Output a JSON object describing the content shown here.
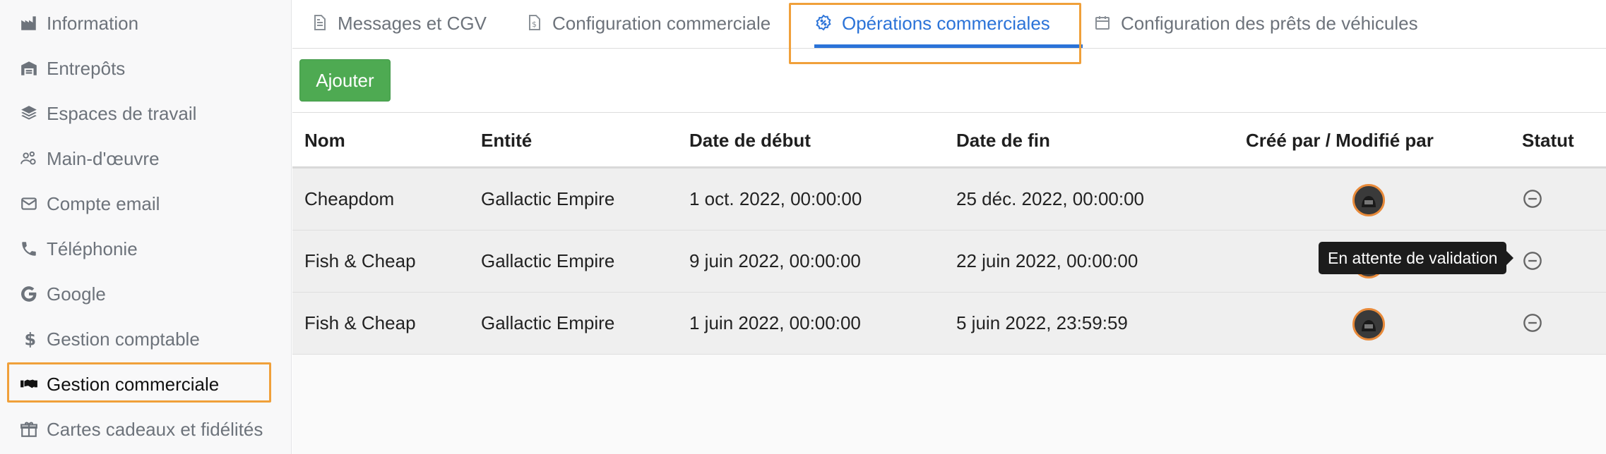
{
  "sidebar": {
    "items": [
      {
        "label": "Information",
        "icon": "industry-icon"
      },
      {
        "label": "Entrepôts",
        "icon": "warehouse-icon"
      },
      {
        "label": "Espaces de travail",
        "icon": "layers-icon"
      },
      {
        "label": "Main-d'œuvre",
        "icon": "users-cog-icon"
      },
      {
        "label": "Compte email",
        "icon": "envelope-icon"
      },
      {
        "label": "Téléphonie",
        "icon": "phone-icon"
      },
      {
        "label": "Google",
        "icon": "google-icon"
      },
      {
        "label": "Gestion comptable",
        "icon": "dollar-icon"
      },
      {
        "label": "Gestion commerciale",
        "icon": "handshake-icon",
        "active": true
      },
      {
        "label": "Cartes cadeaux et fidélités",
        "icon": "gift-icon"
      }
    ]
  },
  "tabs": [
    {
      "label": "Messages et CGV",
      "icon": "document-icon"
    },
    {
      "label": "Configuration commerciale",
      "icon": "file-dollar-icon"
    },
    {
      "label": "Opérations commerciales",
      "icon": "percent-badge-icon",
      "active": true
    },
    {
      "label": "Configuration des prêts de véhicules",
      "icon": "calendar-icon"
    }
  ],
  "toolbar": {
    "add_label": "Ajouter"
  },
  "table": {
    "headers": [
      "Nom",
      "Entité",
      "Date de début",
      "Date de fin",
      "Créé par / Modifié par",
      "Statut"
    ],
    "rows": [
      {
        "nom": "Cheapdom",
        "entite": "Gallactic Empire",
        "debut": "1 oct. 2022, 00:00:00",
        "fin": "25 déc. 2022, 00:00:00"
      },
      {
        "nom": "Fish & Cheap",
        "entite": "Gallactic Empire",
        "debut": "9 juin 2022, 00:00:00",
        "fin": "22 juin 2022, 00:00:00"
      },
      {
        "nom": "Fish & Cheap",
        "entite": "Gallactic Empire",
        "debut": "1 juin 2022, 00:00:00",
        "fin": "5 juin 2022, 23:59:59"
      }
    ]
  },
  "tooltip": {
    "text": "En attente de validation"
  },
  "colors": {
    "accent": "#2b73d8",
    "highlight": "#f0a03a",
    "success": "#4eaa52"
  }
}
